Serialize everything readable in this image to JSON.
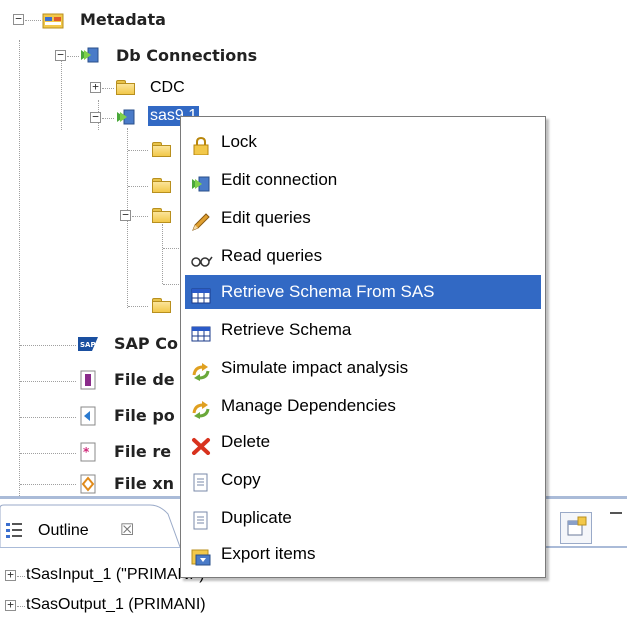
{
  "tree": {
    "metadata": "Metadata",
    "db_connections": "Db Connections",
    "cdc": "CDC",
    "sas_item": "sas9.1",
    "sap": "SAP Co",
    "file_de": "File de",
    "file_po": "File po",
    "file_re": "File re",
    "file_xm": "File xn"
  },
  "menu": {
    "items": [
      {
        "label": "Lock",
        "icon": "lock-icon"
      },
      {
        "label": "Edit connection",
        "icon": "edit-connection-icon"
      },
      {
        "label": "Edit queries",
        "icon": "pencil-icon"
      },
      {
        "label": "Read queries",
        "icon": "glasses-icon"
      },
      {
        "label": "Retrieve Schema From SAS",
        "icon": "table-icon",
        "selected": true
      },
      {
        "label": "Retrieve Schema",
        "icon": "table-icon"
      },
      {
        "label": "Simulate impact analysis",
        "icon": "arrows-icon"
      },
      {
        "label": "Manage Dependencies",
        "icon": "arrows-icon"
      },
      {
        "label": "Delete",
        "icon": "delete-icon"
      },
      {
        "label": "Copy",
        "icon": "copy-icon"
      },
      {
        "label": "Duplicate",
        "icon": "duplicate-icon"
      },
      {
        "label": "Export items",
        "icon": "export-icon"
      }
    ],
    "selected_color": "#3269c4"
  },
  "outline": {
    "tab_label": "Outline",
    "items": [
      "tSasInput_1 (\"PRIMANI\")",
      "tSasOutput_1 (PRIMANI)"
    ]
  }
}
